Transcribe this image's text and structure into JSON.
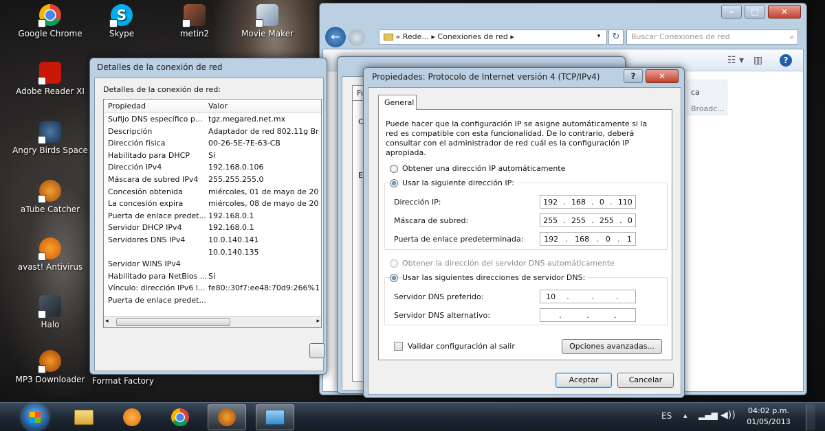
{
  "desktop": {
    "icons": [
      {
        "label": "Google Chrome"
      },
      {
        "label": "Skype"
      },
      {
        "label": "metin2"
      },
      {
        "label": "Movie Maker"
      },
      {
        "label": "Adobe Reader XI"
      },
      {
        "label": "Angry Birds Space"
      },
      {
        "label": "aTube Catcher"
      },
      {
        "label": "avast! Antivirus"
      },
      {
        "label": "Halo"
      },
      {
        "label": "MP3 Downloader"
      },
      {
        "label": "Format Factory"
      }
    ]
  },
  "explorer": {
    "address_sep": "«",
    "address_parts": [
      "Rede...",
      "Conexiones de red"
    ],
    "search_placeholder": "Buscar Conexiones de red",
    "right_fragment_1": "ca",
    "right_fragment_2": "Broadc..."
  },
  "middle_dialog": {
    "tab_fragment": "Fu",
    "frag_c": "C",
    "frag_e": "E"
  },
  "details": {
    "title": "Detalles de la conexión de red",
    "heading": "Detalles de la conexión de red:",
    "col_property": "Propiedad",
    "col_value": "Valor",
    "rows": [
      {
        "p": "Sufijo DNS específico p...",
        "v": "tgz.megared.net.mx"
      },
      {
        "p": "Descripción",
        "v": "Adaptador de red 802.11g Br"
      },
      {
        "p": "Dirección física",
        "v": "00-26-5E-7E-63-CB"
      },
      {
        "p": "Habilitado para DHCP",
        "v": "Sí"
      },
      {
        "p": "Dirección IPv4",
        "v": "192.168.0.106"
      },
      {
        "p": "Máscara de subred IPv4",
        "v": "255.255.255.0"
      },
      {
        "p": "Concesión obtenida",
        "v": "miércoles, 01 de mayo de 20"
      },
      {
        "p": "La concesión expira",
        "v": "miércoles, 08 de mayo de 20"
      },
      {
        "p": "Puerta de enlace predet...",
        "v": "192.168.0.1"
      },
      {
        "p": "Servidor DHCP IPv4",
        "v": "192.168.0.1"
      },
      {
        "p": "Servidores DNS IPv4",
        "v": "10.0.140.141"
      },
      {
        "p": "",
        "v": "10.0.140.135"
      },
      {
        "p": "Servidor WINS IPv4",
        "v": ""
      },
      {
        "p": "Habilitado para NetBios ...",
        "v": "Sí"
      },
      {
        "p": "Vínculo: dirección IPv6 l...",
        "v": "fe80::30f7:ee48:70d9:266%1"
      },
      {
        "p": "Puerta de enlace predet...",
        "v": ""
      }
    ]
  },
  "ipv4": {
    "title": "Propiedades: Protocolo de Internet versión 4 (TCP/IPv4)",
    "help_glyph": "?",
    "tab_general": "General",
    "description": "Puede hacer que la configuración IP se asigne automáticamente si la red es compatible con esta funcionalidad. De lo contrario, deberá consultar con el administrador de red cuál es la configuración IP apropiada.",
    "radio_auto_ip": "Obtener una dirección IP automáticamente",
    "radio_manual_ip": "Usar la siguiente dirección IP:",
    "label_ip": "Dirección IP:",
    "value_ip": [
      "192",
      "168",
      "0",
      "110"
    ],
    "label_mask": "Máscara de subred:",
    "value_mask": [
      "255",
      "255",
      "255",
      "0"
    ],
    "label_gateway": "Puerta de enlace predeterminada:",
    "value_gateway": [
      "192",
      "168",
      "0",
      "1"
    ],
    "radio_auto_dns": "Obtener la dirección del servidor DNS automáticamente",
    "radio_manual_dns": "Usar las siguientes direcciones de servidor DNS:",
    "label_dns_pref": "Servidor DNS preferido:",
    "value_dns_pref": [
      "10",
      "",
      "",
      ""
    ],
    "label_dns_alt": "Servidor DNS alternativo:",
    "value_dns_alt": [
      "",
      "",
      "",
      ""
    ],
    "validate_label": "Validar configuración al salir",
    "advanced_button": "Opciones avanzadas...",
    "ok_button": "Aceptar",
    "cancel_button": "Cancelar"
  },
  "taskbar": {
    "time": "04:02 p.m.",
    "date": "01/05/2013"
  },
  "colors": {
    "accent": "#3c7fb1",
    "window_frame": "#bcd0e3",
    "client_bg": "#f0f0f0"
  }
}
